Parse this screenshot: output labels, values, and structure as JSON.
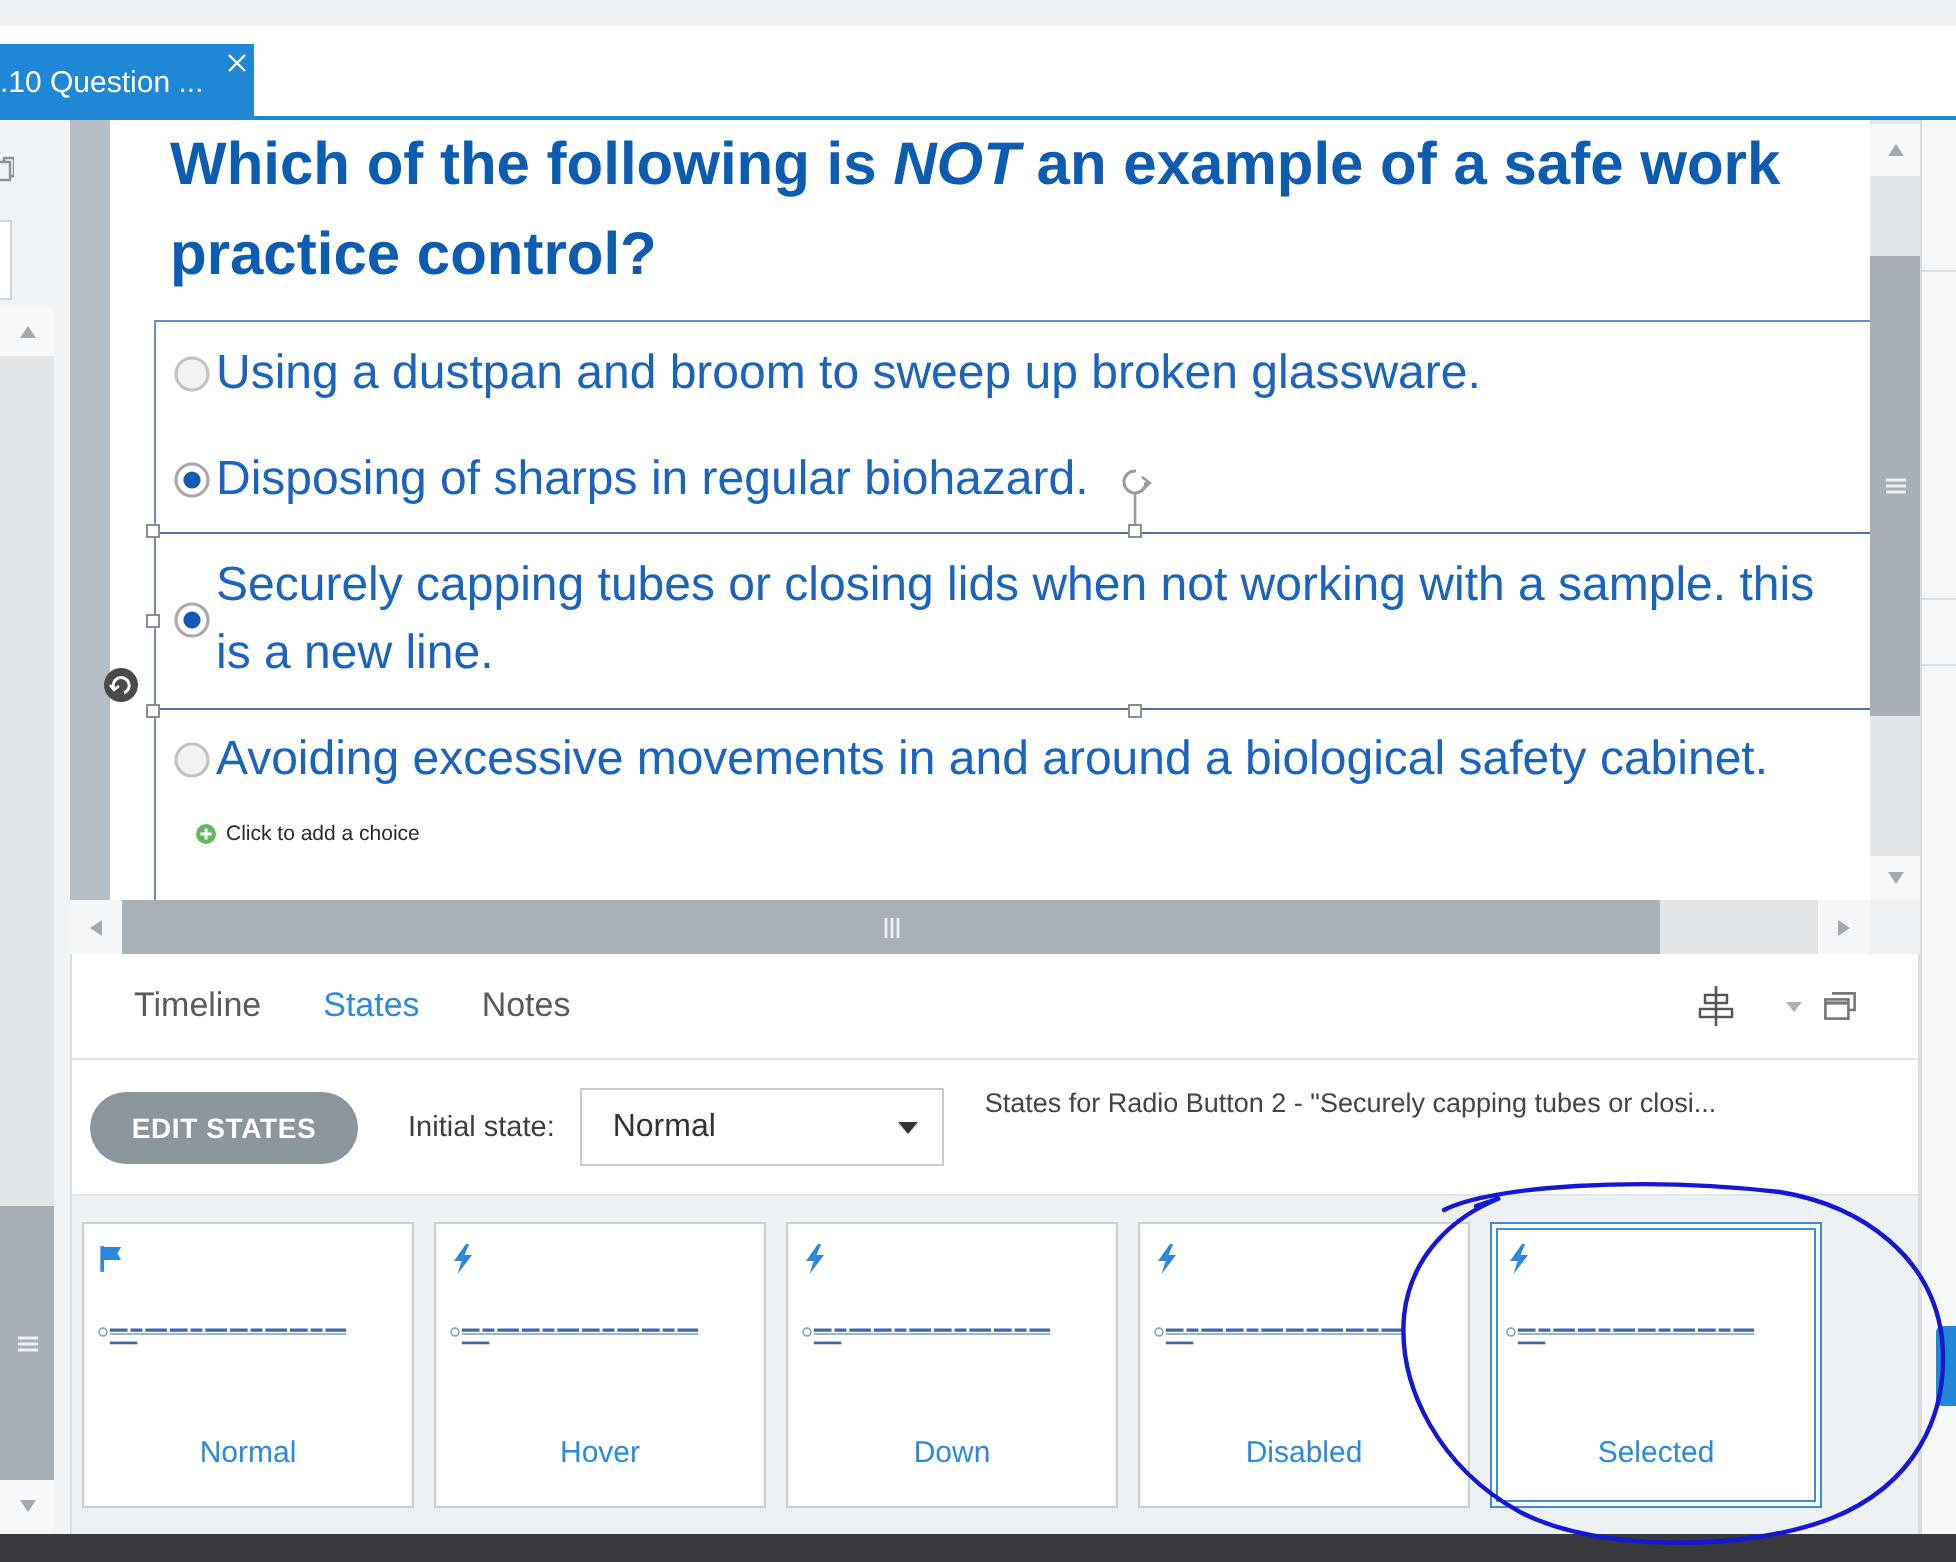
{
  "tab": {
    "label": ".10 Question ...",
    "selected": true
  },
  "question": {
    "text": "Which of the following is *NOT* an example of a safe work practice control?"
  },
  "choices": [
    {
      "label": "Using a dustpan and broom to sweep up broken glassware.",
      "checked": false,
      "selected": false
    },
    {
      "label": "Disposing of sharps in regular biohazard.",
      "checked": true,
      "selected": false
    },
    {
      "label": "Securely capping tubes or closing lids when not working with a sample. this is a new line.",
      "checked": true,
      "selected": true
    },
    {
      "label": "Avoiding excessive movements in and around a biological safety cabinet.",
      "checked": false,
      "selected": false
    }
  ],
  "add_choice": {
    "label": "Click to add a choice"
  },
  "panel_tabs": [
    {
      "label": "Timeline",
      "selected": false
    },
    {
      "label": "States",
      "selected": true
    },
    {
      "label": "Notes",
      "selected": false
    }
  ],
  "edit_states_button": {
    "label": "EDIT STATES"
  },
  "initial_state": {
    "label": "Initial state:",
    "value": "Normal"
  },
  "states_caption": "States for Radio Button 2 - \"Securely capping tubes or closi...",
  "states": [
    {
      "label": "Normal",
      "kind": "flag",
      "selected": false
    },
    {
      "label": "Hover",
      "kind": "bolt",
      "selected": false
    },
    {
      "label": "Down",
      "kind": "bolt",
      "selected": false
    },
    {
      "label": "Disabled",
      "kind": "bolt",
      "selected": false
    },
    {
      "label": "Selected",
      "kind": "bolt",
      "selected": true
    }
  ]
}
